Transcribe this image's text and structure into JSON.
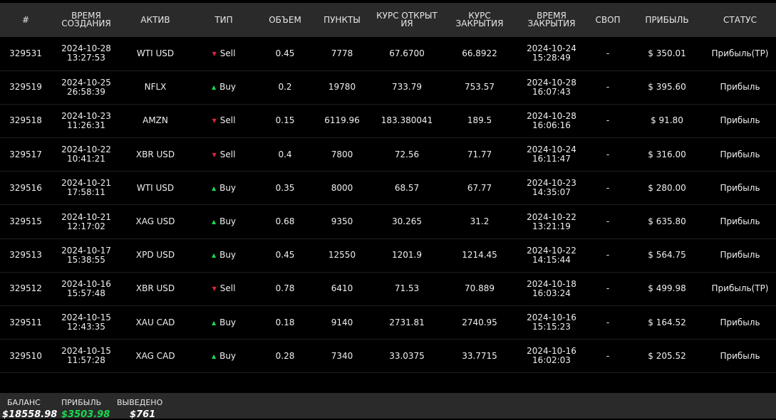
{
  "colors": {
    "profit": "#18d94f",
    "loss": "#e0263b",
    "header_bg": "#2a2a2a"
  },
  "table": {
    "headers": [
      "#",
      "ВРЕМЯ СОЗДАНИЯ",
      "АКТИВ",
      "ТИП",
      "ОБЪЕМ",
      "ПУНКТЫ",
      "КУРС ОТКРЫТИЯ",
      "КУРС ЗАКРЫТИЯ",
      "ВРЕМЯ ЗАКРЫТИЯ",
      "СВОП",
      "ПРИБЫЛЬ",
      "СТАТУС"
    ],
    "rows": [
      {
        "id": "329531",
        "created_date": "2024-10-28",
        "created_time": "13:27:53",
        "asset": "WTI USD",
        "type": "Sell",
        "volume": "0.45",
        "points": "7778",
        "open": "67.6700",
        "close": "66.8922",
        "closed_date": "2024-10-24",
        "closed_time": "15:28:49",
        "swap": "-",
        "profit": "$ 350.01",
        "status": "Прибыль(TP)"
      },
      {
        "id": "329519",
        "created_date": "2024-10-25",
        "created_time": "26:58:39",
        "asset": "NFLX",
        "type": "Buy",
        "volume": "0.2",
        "points": "19780",
        "open": "733.79",
        "close": "753.57",
        "closed_date": "2024-10-28",
        "closed_time": "16:07:43",
        "swap": "-",
        "profit": "$ 395.60",
        "status": "Прибыль"
      },
      {
        "id": "329518",
        "created_date": "2024-10-23",
        "created_time": "11:26:31",
        "asset": "AMZN",
        "type": "Sell",
        "volume": "0.15",
        "points": "6119.96",
        "open": "183.380041",
        "close": "189.5",
        "closed_date": "2024-10-28",
        "closed_time": "16:06:16",
        "swap": "-",
        "profit": "$ 91.80",
        "status": "Прибыль"
      },
      {
        "id": "329517",
        "created_date": "2024-10-22",
        "created_time": "10:41:21",
        "asset": "XBR USD",
        "type": "Sell",
        "volume": "0.4",
        "points": "7800",
        "open": "72.56",
        "close": "71.77",
        "closed_date": "2024-10-24",
        "closed_time": "16:11:47",
        "swap": "-",
        "profit": "$ 316.00",
        "status": "Прибыль"
      },
      {
        "id": "329516",
        "created_date": "2024-10-21",
        "created_time": "17:58:11",
        "asset": "WTI USD",
        "type": "Buy",
        "volume": "0.35",
        "points": "8000",
        "open": "68.57",
        "close": "67.77",
        "closed_date": "2024-10-23",
        "closed_time": "14:35:07",
        "swap": "-",
        "profit": "$ 280.00",
        "status": "Прибыль"
      },
      {
        "id": "329515",
        "created_date": "2024-10-21",
        "created_time": "12:17:02",
        "asset": "XAG USD",
        "type": "Buy",
        "volume": "0.68",
        "points": "9350",
        "open": "30.265",
        "close": "31.2",
        "closed_date": "2024-10-22",
        "closed_time": "13:21:19",
        "swap": "-",
        "profit": "$ 635.80",
        "status": "Прибыль"
      },
      {
        "id": "329513",
        "created_date": "2024-10-17",
        "created_time": "15:38:55",
        "asset": "XPD USD",
        "type": "Buy",
        "volume": "0.45",
        "points": "12550",
        "open": "1201.9",
        "close": "1214.45",
        "closed_date": "2024-10-22",
        "closed_time": "14:15:44",
        "swap": "-",
        "profit": "$ 564.75",
        "status": "Прибыль"
      },
      {
        "id": "329512",
        "created_date": "2024-10-16",
        "created_time": "15:57:48",
        "asset": "XBR USD",
        "type": "Sell",
        "volume": "0.78",
        "points": "6410",
        "open": "71.53",
        "close": "70.889",
        "closed_date": "2024-10-18",
        "closed_time": "16:03:24",
        "swap": "-",
        "profit": "$ 499.98",
        "status": "Прибыль(TP)"
      },
      {
        "id": "329511",
        "created_date": "2024-10-15",
        "created_time": "12:43:35",
        "asset": "XAU CAD",
        "type": "Buy",
        "volume": "0.18",
        "points": "9140",
        "open": "2731.81",
        "close": "2740.95",
        "closed_date": "2024-10-16",
        "closed_time": "15:15:23",
        "swap": "-",
        "profit": "$ 164.52",
        "status": "Прибыль"
      },
      {
        "id": "329510",
        "created_date": "2024-10-15",
        "created_time": "11:57:28",
        "asset": "XAG CAD",
        "type": "Buy",
        "volume": "0.28",
        "points": "7340",
        "open": "33.0375",
        "close": "33.7715",
        "closed_date": "2024-10-16",
        "closed_time": "16:02:03",
        "swap": "-",
        "profit": "$ 205.52",
        "status": "Прибыль"
      }
    ]
  },
  "footer": {
    "balance_label": "БАЛАНС",
    "balance_value": "$18558.98",
    "profit_label": "ПРИБЫЛЬ",
    "profit_value": "$3503.98",
    "withdrawn_label": "ВЫВЕДЕНО",
    "withdrawn_value": "$761"
  }
}
